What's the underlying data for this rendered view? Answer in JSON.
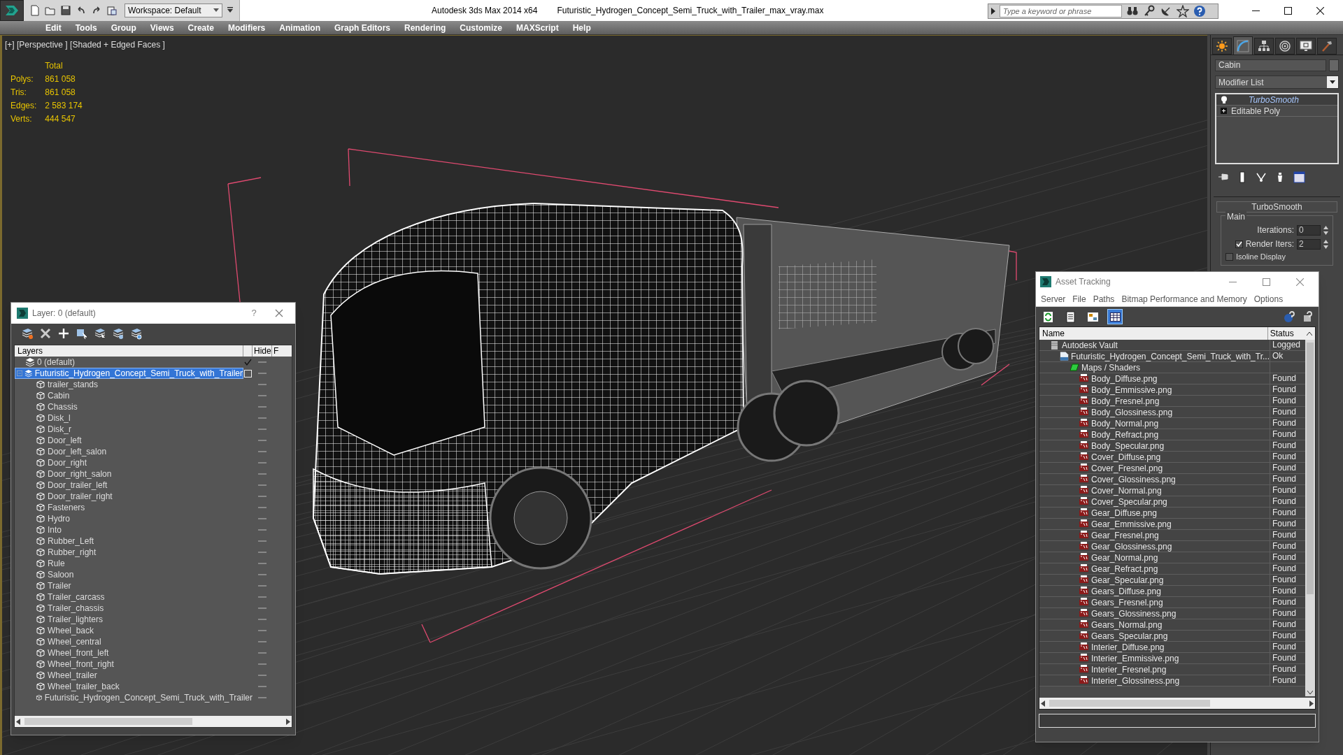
{
  "window": {
    "title": "Autodesk 3ds Max  2014 x64",
    "file": "Futuristic_Hydrogen_Concept_Semi_Truck_with_Trailer_max_vray.max"
  },
  "toolbar": {
    "workspace": "Workspace: Default",
    "search_placeholder": "Type a keyword or phrase"
  },
  "menu": [
    "Edit",
    "Tools",
    "Group",
    "Views",
    "Create",
    "Modifiers",
    "Animation",
    "Graph Editors",
    "Rendering",
    "Customize",
    "MAXScript",
    "Help"
  ],
  "viewport": {
    "label": "[+] [Perspective ] [Shaded + Edged Faces ]",
    "stats_header": "Total",
    "stats": [
      {
        "label": "Polys:",
        "value": "861 058"
      },
      {
        "label": "Tris:",
        "value": "861 058"
      },
      {
        "label": "Edges:",
        "value": "2 583 174"
      },
      {
        "label": "Verts:",
        "value": "444 547"
      }
    ]
  },
  "command_panel": {
    "tabs": [
      {
        "kind": "create",
        "selected": false
      },
      {
        "kind": "modify",
        "selected": true
      },
      {
        "kind": "hierarchy",
        "selected": false
      },
      {
        "kind": "motion",
        "selected": false
      },
      {
        "kind": "display",
        "selected": false
      },
      {
        "kind": "utilities",
        "selected": false
      }
    ],
    "object_name": "Cabin",
    "modifier_list": "Modifier List",
    "stack": [
      {
        "label": "TurboSmooth",
        "kind": "modifier"
      },
      {
        "label": "Editable Poly",
        "kind": "base"
      }
    ],
    "rollout": {
      "title": "TurboSmooth",
      "group": "Main",
      "iterations_label": "Iterations:",
      "iterations": "0",
      "render_iters_label": "Render Iters:",
      "render_iters": "2",
      "render_iters_checked": true,
      "isoline_label": "Isoline Display",
      "isoline_checked": false
    }
  },
  "layer_dialog": {
    "title": "Layer: 0 (default)",
    "help": "?",
    "columns": [
      "Layers",
      "Hide",
      "F"
    ],
    "layers": [
      {
        "name": "0 (default)",
        "current": true,
        "selected": false
      },
      {
        "name": "Futuristic_Hydrogen_Concept_Semi_Truck_with_Trailer",
        "current": false,
        "selected": true,
        "expanded": true,
        "children": [
          {
            "name": "trailer_stands"
          },
          {
            "name": "Cabin"
          },
          {
            "name": "Chassis"
          },
          {
            "name": "Disk_l"
          },
          {
            "name": "Disk_r"
          },
          {
            "name": "Door_left"
          },
          {
            "name": "Door_left_salon"
          },
          {
            "name": "Door_right"
          },
          {
            "name": "Door_right_salon"
          },
          {
            "name": "Door_trailer_left"
          },
          {
            "name": "Door_trailer_right"
          },
          {
            "name": "Fasteners"
          },
          {
            "name": "Hydro"
          },
          {
            "name": "Into"
          },
          {
            "name": "Rubber_Left"
          },
          {
            "name": "Rubber_right"
          },
          {
            "name": "Rule"
          },
          {
            "name": "Saloon"
          },
          {
            "name": "Trailer"
          },
          {
            "name": "Trailer_carcass"
          },
          {
            "name": "Trailer_chassis"
          },
          {
            "name": "Trailer_lighters"
          },
          {
            "name": "Wheel_back"
          },
          {
            "name": "Wheel_central"
          },
          {
            "name": "Wheel_front_left"
          },
          {
            "name": "Wheel_front_right"
          },
          {
            "name": "Wheel_trailer"
          },
          {
            "name": "Wheel_trailer_back"
          },
          {
            "name": "Futuristic_Hydrogen_Concept_Semi_Truck_with_Trailer"
          }
        ]
      }
    ]
  },
  "asset_tracking": {
    "title": "Asset Tracking",
    "menu": [
      "Server",
      "File",
      "Paths",
      "Bitmap Performance and Memory",
      "Options"
    ],
    "tools": [
      {
        "kind": "refresh",
        "selected": false
      },
      {
        "kind": "list",
        "selected": false
      },
      {
        "kind": "thumbnails",
        "selected": false
      },
      {
        "kind": "table",
        "selected": true
      }
    ],
    "columns": [
      "Name",
      "Status"
    ],
    "tree": [
      {
        "name": "Autodesk Vault",
        "status": "Logged",
        "kind": "vault",
        "children": [
          {
            "name": "Futuristic_Hydrogen_Concept_Semi_Truck_with_Tr...",
            "status": "Ok",
            "kind": "max",
            "children": [
              {
                "name": "Maps / Shaders",
                "kind": "folder",
                "children": [
                  {
                    "name": "Body_Diffuse.png",
                    "status": "Found",
                    "kind": "png"
                  },
                  {
                    "name": "Body_Emmissive.png",
                    "status": "Found",
                    "kind": "png"
                  },
                  {
                    "name": "Body_Fresnel.png",
                    "status": "Found",
                    "kind": "png"
                  },
                  {
                    "name": "Body_Glossiness.png",
                    "status": "Found",
                    "kind": "png"
                  },
                  {
                    "name": "Body_Normal.png",
                    "status": "Found",
                    "kind": "png"
                  },
                  {
                    "name": "Body_Refract.png",
                    "status": "Found",
                    "kind": "png"
                  },
                  {
                    "name": "Body_Specular.png",
                    "status": "Found",
                    "kind": "png"
                  },
                  {
                    "name": "Cover_Diffuse.png",
                    "status": "Found",
                    "kind": "png"
                  },
                  {
                    "name": "Cover_Fresnel.png",
                    "status": "Found",
                    "kind": "png"
                  },
                  {
                    "name": "Cover_Glossiness.png",
                    "status": "Found",
                    "kind": "png"
                  },
                  {
                    "name": "Cover_Normal.png",
                    "status": "Found",
                    "kind": "png"
                  },
                  {
                    "name": "Cover_Specular.png",
                    "status": "Found",
                    "kind": "png"
                  },
                  {
                    "name": "Gear_Diffuse.png",
                    "status": "Found",
                    "kind": "png"
                  },
                  {
                    "name": "Gear_Emmissive.png",
                    "status": "Found",
                    "kind": "png"
                  },
                  {
                    "name": "Gear_Fresnel.png",
                    "status": "Found",
                    "kind": "png"
                  },
                  {
                    "name": "Gear_Glossiness.png",
                    "status": "Found",
                    "kind": "png"
                  },
                  {
                    "name": "Gear_Normal.png",
                    "status": "Found",
                    "kind": "png"
                  },
                  {
                    "name": "Gear_Refract.png",
                    "status": "Found",
                    "kind": "png"
                  },
                  {
                    "name": "Gear_Specular.png",
                    "status": "Found",
                    "kind": "png"
                  },
                  {
                    "name": "Gears_Diffuse.png",
                    "status": "Found",
                    "kind": "png"
                  },
                  {
                    "name": "Gears_Fresnel.png",
                    "status": "Found",
                    "kind": "png"
                  },
                  {
                    "name": "Gears_Glossiness.png",
                    "status": "Found",
                    "kind": "png"
                  },
                  {
                    "name": "Gears_Normal.png",
                    "status": "Found",
                    "kind": "png"
                  },
                  {
                    "name": "Gears_Specular.png",
                    "status": "Found",
                    "kind": "png"
                  },
                  {
                    "name": "Interier_Diffuse.png",
                    "status": "Found",
                    "kind": "png"
                  },
                  {
                    "name": "Interier_Emmissive.png",
                    "status": "Found",
                    "kind": "png"
                  },
                  {
                    "name": "Interier_Fresnel.png",
                    "status": "Found",
                    "kind": "png"
                  },
                  {
                    "name": "Interier_Glossiness.png",
                    "status": "Found",
                    "kind": "png"
                  }
                ]
              }
            ]
          }
        ]
      }
    ]
  }
}
